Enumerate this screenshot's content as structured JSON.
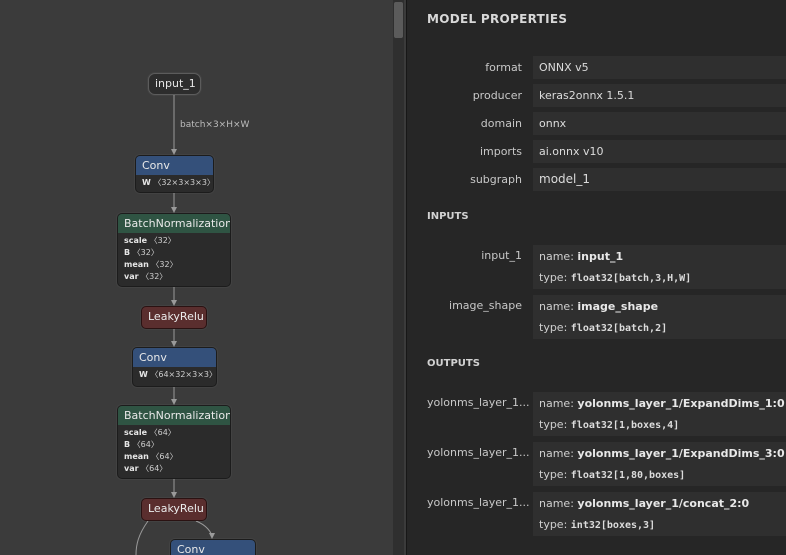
{
  "graph": {
    "input_node": "input_1",
    "edge_label": "batch×3×H×W",
    "nodes": [
      {
        "op": "Conv",
        "attrs": [
          {
            "k": "W",
            "v": "〈32×3×3×3〉"
          }
        ]
      },
      {
        "op": "BatchNormalization",
        "attrs": [
          {
            "k": "scale",
            "v": "〈32〉"
          },
          {
            "k": "B",
            "v": "〈32〉"
          },
          {
            "k": "mean",
            "v": "〈32〉"
          },
          {
            "k": "var",
            "v": "〈32〉"
          }
        ]
      },
      {
        "op": "LeakyRelu"
      },
      {
        "op": "Conv",
        "attrs": [
          {
            "k": "W",
            "v": "〈64×32×3×3〉"
          }
        ]
      },
      {
        "op": "BatchNormalization",
        "attrs": [
          {
            "k": "scale",
            "v": "〈64〉"
          },
          {
            "k": "B",
            "v": "〈64〉"
          },
          {
            "k": "mean",
            "v": "〈64〉"
          },
          {
            "k": "var",
            "v": "〈64〉"
          }
        ]
      },
      {
        "op": "LeakyRelu"
      },
      {
        "op": "Conv"
      }
    ]
  },
  "panel": {
    "title": "MODEL PROPERTIES",
    "properties": [
      {
        "label": "format",
        "value": "ONNX v5"
      },
      {
        "label": "producer",
        "value": "keras2onnx 1.5.1"
      },
      {
        "label": "domain",
        "value": "onnx"
      },
      {
        "label": "imports",
        "value": "ai.onnx v10"
      },
      {
        "label": "subgraph",
        "value": "model_1"
      }
    ],
    "inputs_title": "INPUTS",
    "inputs": [
      {
        "label": "input_1",
        "name_key": "name: ",
        "name": "input_1",
        "type_key": "type: ",
        "type": "float32[batch,3,H,W]"
      },
      {
        "label": "image_shape",
        "name_key": "name: ",
        "name": "image_shape",
        "type_key": "type: ",
        "type": "float32[batch,2]"
      }
    ],
    "outputs_title": "OUTPUTS",
    "outputs": [
      {
        "label": "yolonms_layer_1...",
        "name_key": "name: ",
        "name": "yolonms_layer_1/ExpandDims_1:0",
        "type_key": "type: ",
        "type": "float32[1,boxes,4]"
      },
      {
        "label": "yolonms_layer_1...",
        "name_key": "name: ",
        "name": "yolonms_layer_1/ExpandDims_3:0",
        "type_key": "type: ",
        "type": "float32[1,80,boxes]"
      },
      {
        "label": "yolonms_layer_1...",
        "name_key": "name: ",
        "name": "yolonms_layer_1/concat_2:0",
        "type_key": "type: ",
        "type": "int32[boxes,3]"
      }
    ]
  }
}
